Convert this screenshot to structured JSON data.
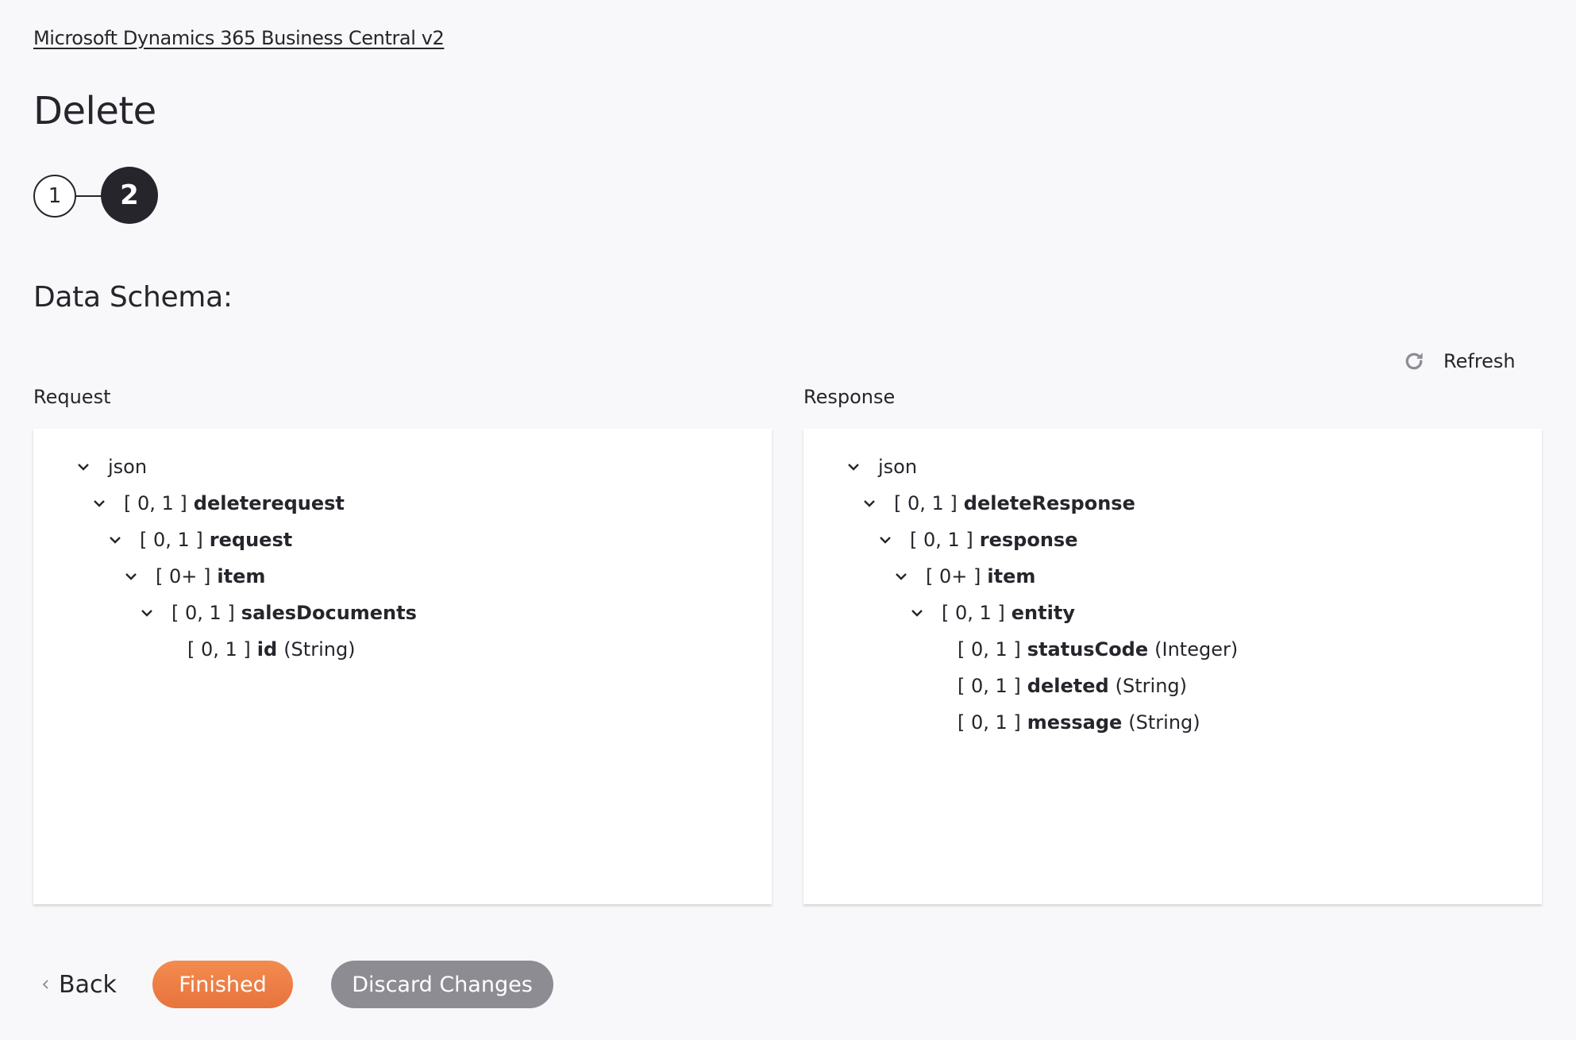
{
  "breadcrumb": "Microsoft Dynamics 365 Business Central v2",
  "title": "Delete",
  "stepper": {
    "steps": [
      "1",
      "2"
    ],
    "current": 2
  },
  "section_title": "Data Schema:",
  "refresh": {
    "label": "Refresh",
    "icon": "refresh-icon"
  },
  "request": {
    "label": "Request",
    "tree": [
      {
        "depth": 0,
        "expandable": true,
        "card": "",
        "name": "json",
        "type": "",
        "bold": false
      },
      {
        "depth": 1,
        "expandable": true,
        "card": "[ 0, 1 ]",
        "name": "deleterequest",
        "type": "",
        "bold": true
      },
      {
        "depth": 2,
        "expandable": true,
        "card": "[ 0, 1 ]",
        "name": "request",
        "type": "",
        "bold": true
      },
      {
        "depth": 3,
        "expandable": true,
        "card": "[ 0+ ]",
        "name": "item",
        "type": "",
        "bold": true
      },
      {
        "depth": 4,
        "expandable": true,
        "card": "[ 0, 1 ]",
        "name": "salesDocuments",
        "type": "",
        "bold": true
      },
      {
        "depth": 5,
        "expandable": false,
        "card": "[ 0, 1 ]",
        "name": "id",
        "type": "(String)",
        "bold": true
      }
    ]
  },
  "response": {
    "label": "Response",
    "tree": [
      {
        "depth": 0,
        "expandable": true,
        "card": "",
        "name": "json",
        "type": "",
        "bold": false
      },
      {
        "depth": 1,
        "expandable": true,
        "card": "[ 0, 1 ]",
        "name": "deleteResponse",
        "type": "",
        "bold": true
      },
      {
        "depth": 2,
        "expandable": true,
        "card": "[ 0, 1 ]",
        "name": "response",
        "type": "",
        "bold": true
      },
      {
        "depth": 3,
        "expandable": true,
        "card": "[ 0+ ]",
        "name": "item",
        "type": "",
        "bold": true
      },
      {
        "depth": 4,
        "expandable": true,
        "card": "[ 0, 1 ]",
        "name": "entity",
        "type": "",
        "bold": true
      },
      {
        "depth": 5,
        "expandable": false,
        "card": "[ 0, 1 ]",
        "name": "statusCode",
        "type": "(Integer)",
        "bold": true
      },
      {
        "depth": 5,
        "expandable": false,
        "card": "[ 0, 1 ]",
        "name": "deleted",
        "type": "(String)",
        "bold": true
      },
      {
        "depth": 5,
        "expandable": false,
        "card": "[ 0, 1 ]",
        "name": "message",
        "type": "(String)",
        "bold": true
      }
    ]
  },
  "footer": {
    "back_label": "Back",
    "finished_label": "Finished",
    "discard_label": "Discard Changes"
  },
  "colors": {
    "primary": "#e97a42",
    "secondary": "#8e8c93",
    "text": "#26252b",
    "background": "#f8f8fa"
  }
}
